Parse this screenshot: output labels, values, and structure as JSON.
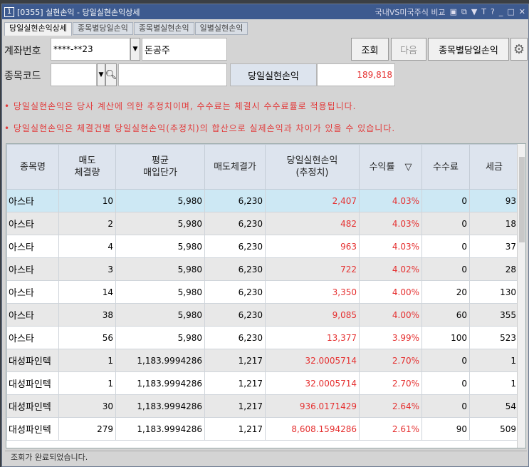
{
  "window": {
    "num": "1",
    "title": "[0355]  실현손익  - 당일실현손익상세",
    "compare": "국내VS미국주식 비교",
    "icons": [
      "layout-icon",
      "copy-icon",
      "pin-icon",
      "T",
      "?",
      "minimize-icon",
      "maximize-icon",
      "close-icon"
    ]
  },
  "tabs": [
    "당일실현손익상세",
    "종목별당일손익",
    "종목별실현손익",
    "일별실현손익"
  ],
  "form": {
    "account_label": "계좌번호",
    "account_value": "****-**23",
    "account_name": "돈공주",
    "code_label": "종목코드",
    "code_value": "",
    "code_name": "",
    "query_btn": "조회",
    "next_btn": "다음",
    "by_item_btn": "종목별당일손익",
    "pnl_label": "당일실현손익",
    "pnl_value": "189,818"
  },
  "notices": [
    "• 당일실현손익은 당사 계산에 의한 추정치이며, 수수료는 체결시 수수료률로 적용됩니다.",
    "• 당일실현손익은 체결건별 당일실현손익(추정치)의 합산으로 실제손익과 차이가 있을 수 있습니다."
  ],
  "table": {
    "headers": [
      "종목명",
      "매도\n체결량",
      "평균\n매입단가",
      "매도체결가",
      "당일실현손익\n(추정치)",
      "수익률",
      "수수료",
      "세금"
    ],
    "sort_icon": "▽",
    "rows": [
      [
        "아스타",
        "10",
        "5,980",
        "6,230",
        "2,407",
        "4.03%",
        "0",
        "93"
      ],
      [
        "아스타",
        "2",
        "5,980",
        "6,230",
        "482",
        "4.03%",
        "0",
        "18"
      ],
      [
        "아스타",
        "4",
        "5,980",
        "6,230",
        "963",
        "4.03%",
        "0",
        "37"
      ],
      [
        "아스타",
        "3",
        "5,980",
        "6,230",
        "722",
        "4.02%",
        "0",
        "28"
      ],
      [
        "아스타",
        "14",
        "5,980",
        "6,230",
        "3,350",
        "4.00%",
        "20",
        "130"
      ],
      [
        "아스타",
        "38",
        "5,980",
        "6,230",
        "9,085",
        "4.00%",
        "60",
        "355"
      ],
      [
        "아스타",
        "56",
        "5,980",
        "6,230",
        "13,377",
        "3.99%",
        "100",
        "523"
      ],
      [
        "대성파인텍",
        "1",
        "1,183.9994286",
        "1,217",
        "32.0005714",
        "2.70%",
        "0",
        "1"
      ],
      [
        "대성파인텍",
        "1",
        "1,183.9994286",
        "1,217",
        "32.0005714",
        "2.70%",
        "0",
        "1"
      ],
      [
        "대성파인텍",
        "30",
        "1,183.9994286",
        "1,217",
        "936.0171429",
        "2.64%",
        "0",
        "54"
      ],
      [
        "대성파인텍",
        "279",
        "1,183.9994286",
        "1,217",
        "8,608.1594286",
        "2.61%",
        "90",
        "509"
      ]
    ]
  },
  "status": "조회가 완료되었습니다."
}
